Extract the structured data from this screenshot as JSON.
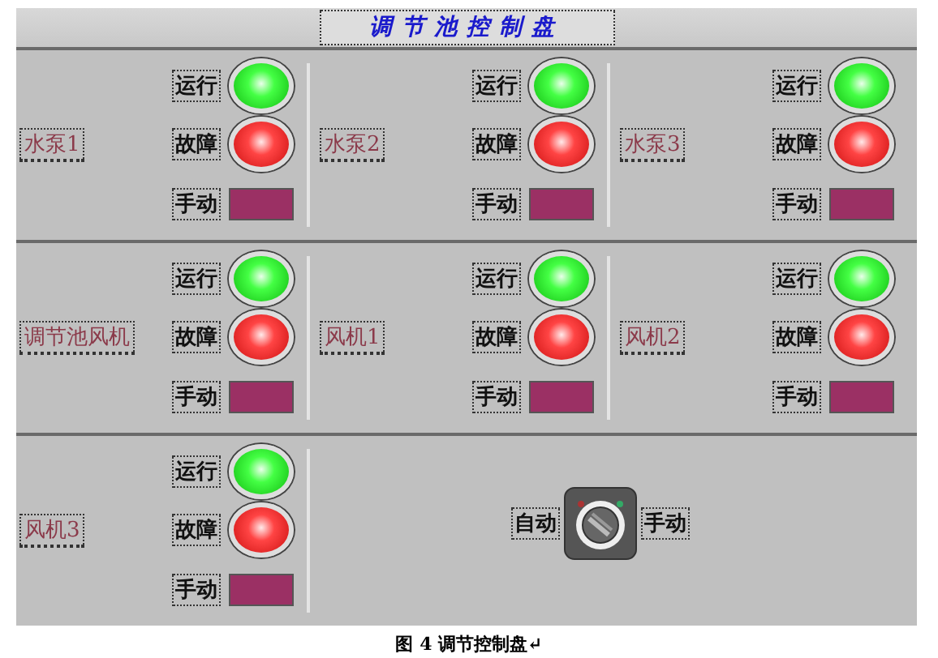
{
  "title": "调节池控制盘",
  "rows": [
    {
      "units": [
        {
          "name": "水泵1",
          "signals": [
            {
              "label": "运行",
              "kind": "run",
              "on": true
            },
            {
              "label": "故障",
              "kind": "fault",
              "on": true
            },
            {
              "label": "手动",
              "kind": "manual",
              "on": true
            }
          ]
        },
        {
          "name": "水泵2",
          "signals": [
            {
              "label": "运行",
              "kind": "run",
              "on": true
            },
            {
              "label": "故障",
              "kind": "fault",
              "on": true
            },
            {
              "label": "手动",
              "kind": "manual",
              "on": true
            }
          ]
        },
        {
          "name": "水泵3",
          "signals": [
            {
              "label": "运行",
              "kind": "run",
              "on": true
            },
            {
              "label": "故障",
              "kind": "fault",
              "on": true
            },
            {
              "label": "手动",
              "kind": "manual",
              "on": true
            }
          ]
        }
      ]
    },
    {
      "units": [
        {
          "name": "调节池风机",
          "signals": [
            {
              "label": "运行",
              "kind": "run",
              "on": true
            },
            {
              "label": "故障",
              "kind": "fault",
              "on": true
            },
            {
              "label": "手动",
              "kind": "manual",
              "on": true
            }
          ]
        },
        {
          "name": "风机1",
          "signals": [
            {
              "label": "运行",
              "kind": "run",
              "on": true
            },
            {
              "label": "故障",
              "kind": "fault",
              "on": true
            },
            {
              "label": "手动",
              "kind": "manual",
              "on": true
            }
          ]
        },
        {
          "name": "风机2",
          "signals": [
            {
              "label": "运行",
              "kind": "run",
              "on": true
            },
            {
              "label": "故障",
              "kind": "fault",
              "on": true
            },
            {
              "label": "手动",
              "kind": "manual",
              "on": true
            }
          ]
        }
      ]
    },
    {
      "units": [
        {
          "name": "风机3",
          "signals": [
            {
              "label": "运行",
              "kind": "run",
              "on": true
            },
            {
              "label": "故障",
              "kind": "fault",
              "on": true
            },
            {
              "label": "手动",
              "kind": "manual",
              "on": true
            }
          ]
        }
      ],
      "selector": {
        "left_label": "自动",
        "right_label": "手动",
        "manual": false
      }
    }
  ],
  "caption": "图 4 调节控制盘↵"
}
